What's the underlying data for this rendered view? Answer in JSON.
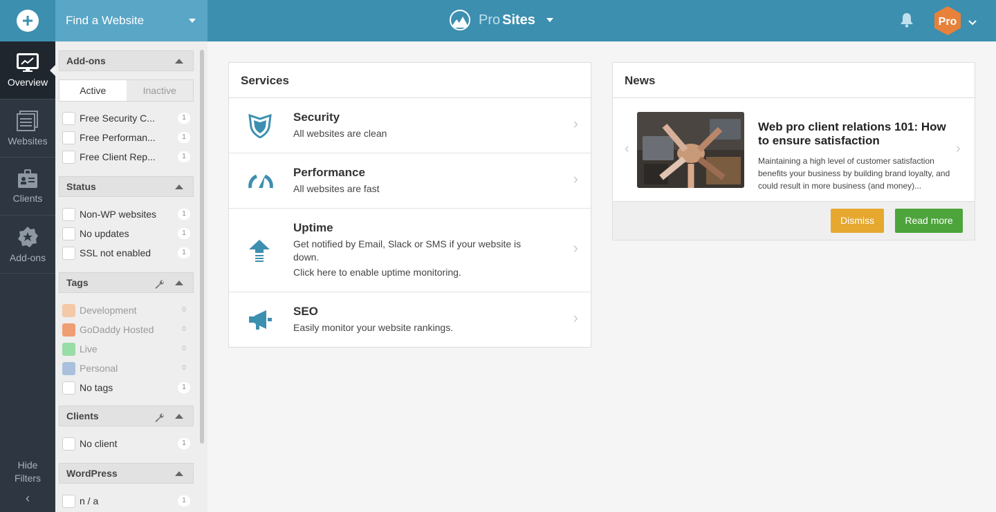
{
  "rail": {
    "add_icon": "plus-icon",
    "items": [
      {
        "label": "Overview",
        "icon": "monitor-icon",
        "active": true
      },
      {
        "label": "Websites",
        "icon": "websites-icon"
      },
      {
        "label": "Clients",
        "icon": "clients-icon"
      },
      {
        "label": "Add-ons",
        "icon": "addons-icon"
      }
    ],
    "hide_line1": "Hide",
    "hide_line2": "Filters",
    "hide_chevron": "‹"
  },
  "topbar": {
    "find_label": "Find a Website",
    "brand_pro": "Pro",
    "brand_sites": "Sites",
    "avatar_text": "Pro",
    "accent": "#3d8fb0",
    "avatar_color": "#e8813a"
  },
  "filters": {
    "addons": {
      "title": "Add-ons",
      "tabs": [
        "Active",
        "Inactive"
      ],
      "items": [
        {
          "label": "Free Security C...",
          "count": "1"
        },
        {
          "label": "Free Performan...",
          "count": "1"
        },
        {
          "label": "Free Client Rep...",
          "count": "1"
        }
      ]
    },
    "status": {
      "title": "Status",
      "items": [
        {
          "label": "Non-WP websites",
          "count": "1"
        },
        {
          "label": "No updates",
          "count": "1"
        },
        {
          "label": "SSL not enabled",
          "count": "1"
        }
      ]
    },
    "tags": {
      "title": "Tags",
      "items": [
        {
          "label": "Development",
          "count": "0",
          "color": "#f3c9a8"
        },
        {
          "label": "GoDaddy Hosted",
          "count": "0",
          "color": "#ee9e72"
        },
        {
          "label": "Live",
          "count": "0",
          "color": "#98dca6"
        },
        {
          "label": "Personal",
          "count": "0",
          "color": "#a9c1dc"
        },
        {
          "label": "No tags",
          "count": "1"
        }
      ]
    },
    "clients": {
      "title": "Clients",
      "items": [
        {
          "label": "No client",
          "count": "1"
        }
      ]
    },
    "wordpress": {
      "title": "WordPress",
      "items": [
        {
          "label": "n / a",
          "count": "1"
        }
      ]
    }
  },
  "services": {
    "title": "Services",
    "items": [
      {
        "name": "Security",
        "desc": "All websites are clean",
        "icon": "shield-icon"
      },
      {
        "name": "Performance",
        "desc": "All websites are fast",
        "icon": "gauge-icon"
      },
      {
        "name": "Uptime",
        "desc": "Get notified by Email, Slack or SMS if your website is down.",
        "desc2": "Click here to enable uptime monitoring.",
        "icon": "upload-arrow-icon"
      },
      {
        "name": "SEO",
        "desc": "Easily monitor your website rankings.",
        "icon": "megaphone-icon"
      }
    ]
  },
  "news": {
    "title": "News",
    "headline": "Web pro client relations 101: How to ensure satisfaction",
    "body": "Maintaining a high level of customer satisfaction benefits your business by building brand loyalty, and could result in more business (and money)...",
    "dismiss": "Dismiss",
    "read_more": "Read more",
    "prev": "‹",
    "next": "›"
  }
}
